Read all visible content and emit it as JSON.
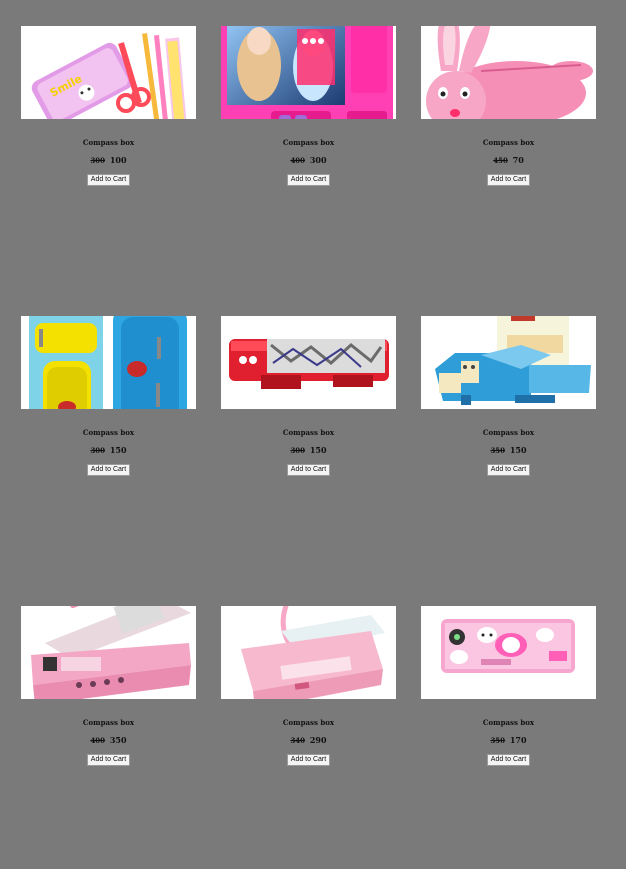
{
  "products": [
    {
      "image": "pink-smile-pencil-box-set-image",
      "name": "Compass box",
      "old_price": "300",
      "price": "100",
      "cart_label": "Add to Cart"
    },
    {
      "image": "frozen-pink-compass-box-image",
      "name": "Compass box",
      "old_price": "400",
      "price": "300",
      "cart_label": "Add to Cart"
    },
    {
      "image": "pink-bunny-plush-pouch-image",
      "name": "Compass box",
      "old_price": "450",
      "price": "70",
      "cart_label": "Add to Cart"
    },
    {
      "image": "yellow-blue-zip-pouches-image",
      "name": "Compass box",
      "old_price": "300",
      "price": "150",
      "cart_label": "Add to Cart"
    },
    {
      "image": "red-transformers-compass-box-image",
      "name": "Compass box",
      "old_price": "300",
      "price": "150",
      "cart_label": "Add to Cart"
    },
    {
      "image": "blue-multi-compartment-box-image",
      "name": "Compass box",
      "old_price": "350",
      "price": "150",
      "cart_label": "Add to Cart"
    },
    {
      "image": "pink-calculator-compass-box-image",
      "name": "Compass box",
      "old_price": "400",
      "price": "350",
      "cart_label": "Add to Cart"
    },
    {
      "image": "pink-lamp-compass-box-image",
      "name": "Compass box",
      "old_price": "340",
      "price": "290",
      "cart_label": "Add to Cart"
    },
    {
      "image": "hello-kitty-compass-box-image",
      "name": "Compass box",
      "old_price": "350",
      "price": "170",
      "cart_label": "Add to Cart"
    }
  ]
}
